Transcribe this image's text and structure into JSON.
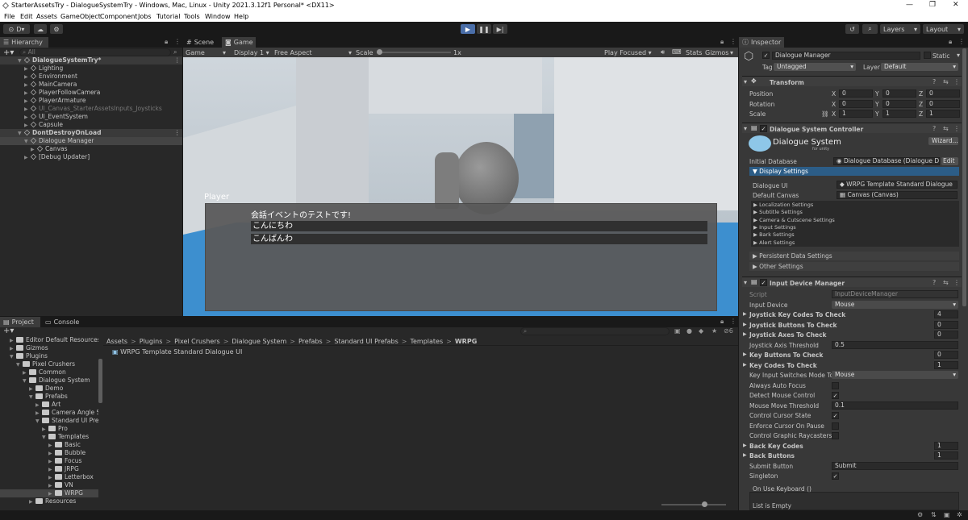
{
  "window": {
    "title": "StarterAssetsTry - DialogueSystemTry - Windows, Mac, Linux - Unity 2021.3.12f1 Personal* <DX11>"
  },
  "menu": [
    "File",
    "Edit",
    "Assets",
    "GameObject",
    "Component",
    "Jobs",
    "Tutorial",
    "Tools",
    "Window",
    "Help"
  ],
  "toolbar": {
    "account": "D",
    "layers": "Layers",
    "layout": "Layout"
  },
  "hierarchy": {
    "tab": "Hierarchy",
    "search_placeholder": "All",
    "items": [
      {
        "label": "DialogueSystemTry*",
        "depth": 0,
        "scene": true
      },
      {
        "label": "Lighting",
        "depth": 1
      },
      {
        "label": "Environment",
        "depth": 1
      },
      {
        "label": "MainCamera",
        "depth": 1
      },
      {
        "label": "PlayerFollowCamera",
        "depth": 1
      },
      {
        "label": "PlayerArmature",
        "depth": 1
      },
      {
        "label": "UI_Canvas_StarterAssetsInputs_Joysticks",
        "depth": 1,
        "dim": true
      },
      {
        "label": "UI_EventSystem",
        "depth": 1
      },
      {
        "label": "Capsule",
        "depth": 1
      },
      {
        "label": "DontDestroyOnLoad",
        "depth": 0,
        "scene": true
      },
      {
        "label": "Dialogue Manager",
        "depth": 1,
        "selected": true
      },
      {
        "label": "Canvas",
        "depth": 2
      },
      {
        "label": "[Debug Updater]",
        "depth": 1
      }
    ]
  },
  "game_view": {
    "tabs": [
      "Scene",
      "Game"
    ],
    "mode": "Game",
    "display": "Display 1",
    "aspect": "Free Aspect",
    "scale_label": "Scale",
    "scale_value": "1x",
    "play_mode": "Play Focused",
    "stats": "Stats",
    "gizmos": "Gizmos",
    "dialogue": {
      "speaker": "Player",
      "subtitle": "会話イベントのテストです!",
      "responses": [
        "こんにちわ",
        "こんばんわ"
      ]
    }
  },
  "project": {
    "tabs": [
      "Project",
      "Console"
    ],
    "tree": [
      {
        "label": "Editor Default Resources",
        "depth": 1
      },
      {
        "label": "Gizmos",
        "depth": 1
      },
      {
        "label": "Plugins",
        "depth": 1,
        "open": true
      },
      {
        "label": "Pixel Crushers",
        "depth": 2,
        "open": true
      },
      {
        "label": "Common",
        "depth": 3
      },
      {
        "label": "Dialogue System",
        "depth": 3,
        "open": true
      },
      {
        "label": "Demo",
        "depth": 4
      },
      {
        "label": "Prefabs",
        "depth": 4,
        "open": true
      },
      {
        "label": "Art",
        "depth": 5
      },
      {
        "label": "Camera Angle S",
        "depth": 5
      },
      {
        "label": "Standard UI Pre",
        "depth": 5,
        "open": true
      },
      {
        "label": "Pro",
        "depth": 6
      },
      {
        "label": "Templates",
        "depth": 6,
        "open": true
      },
      {
        "label": "Basic",
        "depth": 7
      },
      {
        "label": "Bubble",
        "depth": 7
      },
      {
        "label": "Focus",
        "depth": 7
      },
      {
        "label": "JRPG",
        "depth": 7
      },
      {
        "label": "Letterbox",
        "depth": 7
      },
      {
        "label": "VN",
        "depth": 7
      },
      {
        "label": "WRPG",
        "depth": 7,
        "selected": true
      },
      {
        "label": "Resources",
        "depth": 4
      }
    ],
    "breadcrumb": [
      "Assets",
      "Plugins",
      "Pixel Crushers",
      "Dialogue System",
      "Prefabs",
      "Standard UI Prefabs",
      "Templates",
      "WRPG"
    ],
    "assets": [
      "WRPG Template Standard Dialogue UI"
    ],
    "hidden_count": "6"
  },
  "inspector": {
    "tab": "Inspector",
    "object_name": "Dialogue Manager",
    "static_label": "Static",
    "tag_label": "Tag",
    "tag": "Untagged",
    "layer_label": "Layer",
    "layer": "Default",
    "transform": {
      "title": "Transform",
      "rows": [
        {
          "label": "Position",
          "x": "0",
          "y": "0",
          "z": "0"
        },
        {
          "label": "Rotation",
          "x": "0",
          "y": "0",
          "z": "0"
        },
        {
          "label": "Scale",
          "x": "1",
          "y": "1",
          "z": "1"
        }
      ]
    },
    "dsc": {
      "title": "Dialogue System Controller",
      "logo": "Dialogue System",
      "logo_sub": "for unity",
      "wizard": "Wizard...",
      "initial_db_label": "Initial Database",
      "initial_db": "Dialogue Database (Dialogue Da",
      "edit": "Edit",
      "display_settings": "Display Settings",
      "dialogue_ui_label": "Dialogue UI",
      "dialogue_ui": "WRPG Template Standard Dialogue",
      "default_canvas_label": "Default Canvas",
      "default_canvas": "Canvas (Canvas)",
      "sub_settings": [
        "Localization Settings",
        "Subtitle Settings",
        "Camera & Cutscene Settings",
        "Input Settings",
        "Bark Settings",
        "Alert Settings"
      ],
      "persistent": "Persistent Data Settings",
      "other": "Other Settings"
    },
    "idm": {
      "title": "Input Device Manager",
      "script_label": "Script",
      "script": "InputDeviceManager",
      "input_device_label": "Input Device",
      "input_device": "Mouse",
      "joystick_key_codes_label": "Joystick Key Codes To Check",
      "joystick_key_codes": "4",
      "joystick_buttons_label": "Joystick Buttons To Check",
      "joystick_buttons": "0",
      "joystick_axes_label": "Joystick Axes To Check",
      "joystick_axes": "0",
      "joystick_threshold_label": "Joystick Axis Threshold",
      "joystick_threshold": "0.5",
      "key_buttons_label": "Key Buttons To Check",
      "key_buttons": "0",
      "key_codes_label": "Key Codes To Check",
      "key_codes": "1",
      "key_switch_label": "Key Input Switches Mode To",
      "key_switch": "Mouse",
      "always_auto_focus": "Always Auto Focus",
      "detect_mouse": "Detect Mouse Control",
      "mouse_threshold_label": "Mouse Move Threshold",
      "mouse_threshold": "0.1",
      "control_cursor": "Control Cursor State",
      "enforce_cursor": "Enforce Cursor On Pause",
      "control_raycasters": "Control Graphic Raycasters",
      "back_key_codes_label": "Back Key Codes",
      "back_key_codes": "1",
      "back_buttons_label": "Back Buttons",
      "back_buttons": "1",
      "submit_label": "Submit Button",
      "submit": "Submit",
      "singleton": "Singleton",
      "on_use": "On Use Keyboard ()",
      "list_empty": "List is Empty"
    }
  },
  "colors": {
    "accent": "#4a6ea8",
    "selection": "#2c5d87",
    "panel": "#282828"
  }
}
